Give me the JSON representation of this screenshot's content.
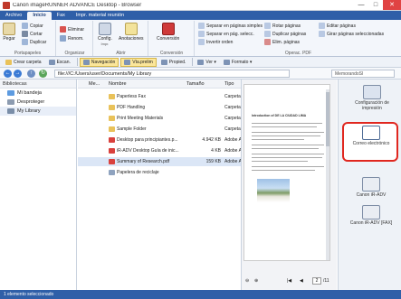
{
  "window": {
    "title": "Canon imageRUNNER ADVANCE Desktop - Browser",
    "minimize": "—",
    "maximize": "□",
    "close": "✕"
  },
  "ribbon_tabs": [
    "Archivo",
    "Inicio",
    "Fax",
    "Impr. material reunión"
  ],
  "ribbon": {
    "portapapeles": {
      "paste": "Pegar",
      "copy": "Copiar",
      "cut": "Cortar",
      "duplicate": "Duplicar",
      "label": "Portapapeles"
    },
    "organizar": {
      "delete": "Eliminar",
      "rename": "Renom.",
      "label": "Organizar"
    },
    "abrir": {
      "config": "Config.",
      "config_sub": "Impr.",
      "annotations": "Anotaciones",
      "label": "Abrir"
    },
    "conversion": {
      "conversion": "Conversión",
      "label": "Conversión"
    },
    "operpdf": {
      "separate_simple": "Separar en páginas simples",
      "separate_selected": "Separar en pág. selecc.",
      "invert": "Invertir orden",
      "rotate": "Rotar páginas",
      "duplicate_pages": "Duplicar páginas",
      "delete_pages": "Elim. páginas",
      "edit_pages": "Editar páginas",
      "rotate_selected": "Girar páginas seleccionadas",
      "label": "Operac. PDF"
    }
  },
  "toolbar": {
    "create_folder": "Crear carpeta",
    "scan": "Escan.",
    "navigation": "Navegación",
    "preview": "Vta.prelim",
    "properties": "Propied.",
    "view": "Ver",
    "format": "Formato"
  },
  "address": {
    "path": "file:///C:/Users/user/Documents/My Library",
    "search_placeholder": "MemorandoSl"
  },
  "left_pane": {
    "header": "Bibliotecas",
    "items": [
      "Mi bandeja",
      "Desproteger",
      "My Library"
    ]
  },
  "list": {
    "columns": {
      "me": "Me...",
      "name": "Nombre",
      "size": "Tamaño",
      "type": "Tipo"
    },
    "rows": [
      {
        "name": "Paperless Fax",
        "size": "",
        "type": "Carpeta"
      },
      {
        "name": "PDF Handling",
        "size": "",
        "type": "Carpeta"
      },
      {
        "name": "Print Meeting Materials",
        "size": "",
        "type": "Carpeta"
      },
      {
        "name": "Sample Folder",
        "size": "",
        "type": "Carpeta"
      },
      {
        "name": "Desktop para principiantes.p...",
        "size": "4.942 KB",
        "type": "Adobe A"
      },
      {
        "name": "iR-ADV Desktop Guía de inic...",
        "size": "4 KB",
        "type": "Adobe A"
      },
      {
        "name": "Summary of Research.pdf",
        "size": "159 KB",
        "type": "Adobe A"
      },
      {
        "name": "Papelera de reciclaje",
        "size": "",
        "type": ""
      }
    ]
  },
  "preview": {
    "doc_title": "Introduction of DE LA CIUDAD LIMA",
    "page_current": "2",
    "page_total": "/11"
  },
  "output_bar": {
    "print_settings": "Configuración de impresión",
    "email": "Correo electrónico",
    "canon_adv": "Canon iR-ADV",
    "canon_adv_fax": "Canon iR-ADV [FAX]"
  },
  "status": {
    "text": "1 elemento seleccionado"
  },
  "colors": {
    "accent": "#2f5fa8",
    "highlight": "#e0271f",
    "selected": "#dbe6f6"
  }
}
